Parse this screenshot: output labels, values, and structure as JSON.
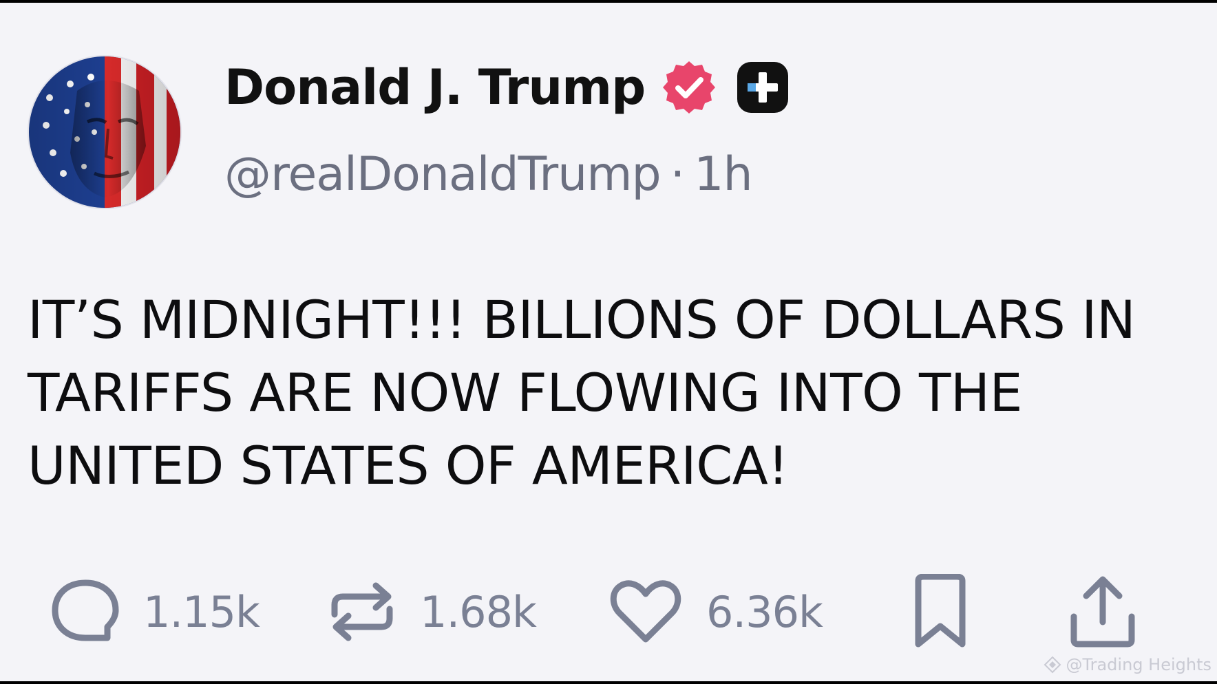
{
  "post": {
    "author": {
      "display_name": "Donald J. Trump",
      "handle": "@realDonaldTrump",
      "separator": "·",
      "time_ago": "1h",
      "verified_icon": "verified-badge-icon",
      "badge_icon": "plus-badge-icon",
      "avatar": "profile-avatar-flag-portrait"
    },
    "text": "IT’S MIDNIGHT!!! BILLIONS OF DOLLARS IN TARIFFS ARE NOW FLOWING INTO THE UNITED STATES OF AMERICA!",
    "actions": {
      "replies": {
        "icon": "reply-icon",
        "count": "1.15k"
      },
      "reposts": {
        "icon": "repost-icon",
        "count": "1.68k"
      },
      "likes": {
        "icon": "heart-icon",
        "count": "6.36k"
      },
      "bookmark": {
        "icon": "bookmark-icon"
      },
      "share": {
        "icon": "share-icon"
      }
    }
  },
  "watermark": {
    "text": "@Trading Heights"
  },
  "colors": {
    "background": "#f4f4f8",
    "text": "#0d0d0f",
    "muted": "#6b6f80",
    "action_icon": "#7a8094",
    "verified": "#e8456b",
    "badge": "#111111"
  }
}
